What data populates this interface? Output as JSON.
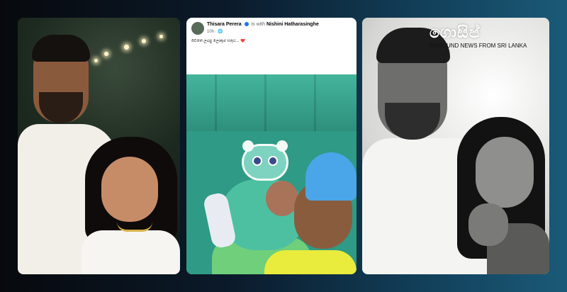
{
  "post": {
    "author": "Thisara Perera",
    "with_label": "is with",
    "tagged": "Nishini Hatharasinghe",
    "time": "10h",
    "privacy_icon": "globe-icon",
    "caption": "ජීවිතේ ලබපු ලොකුම සතුට... ❤️"
  },
  "watermark": {
    "logo": "ගොසිප්",
    "tagline": "RGROUND NEWS FROM SRI LANKA"
  }
}
